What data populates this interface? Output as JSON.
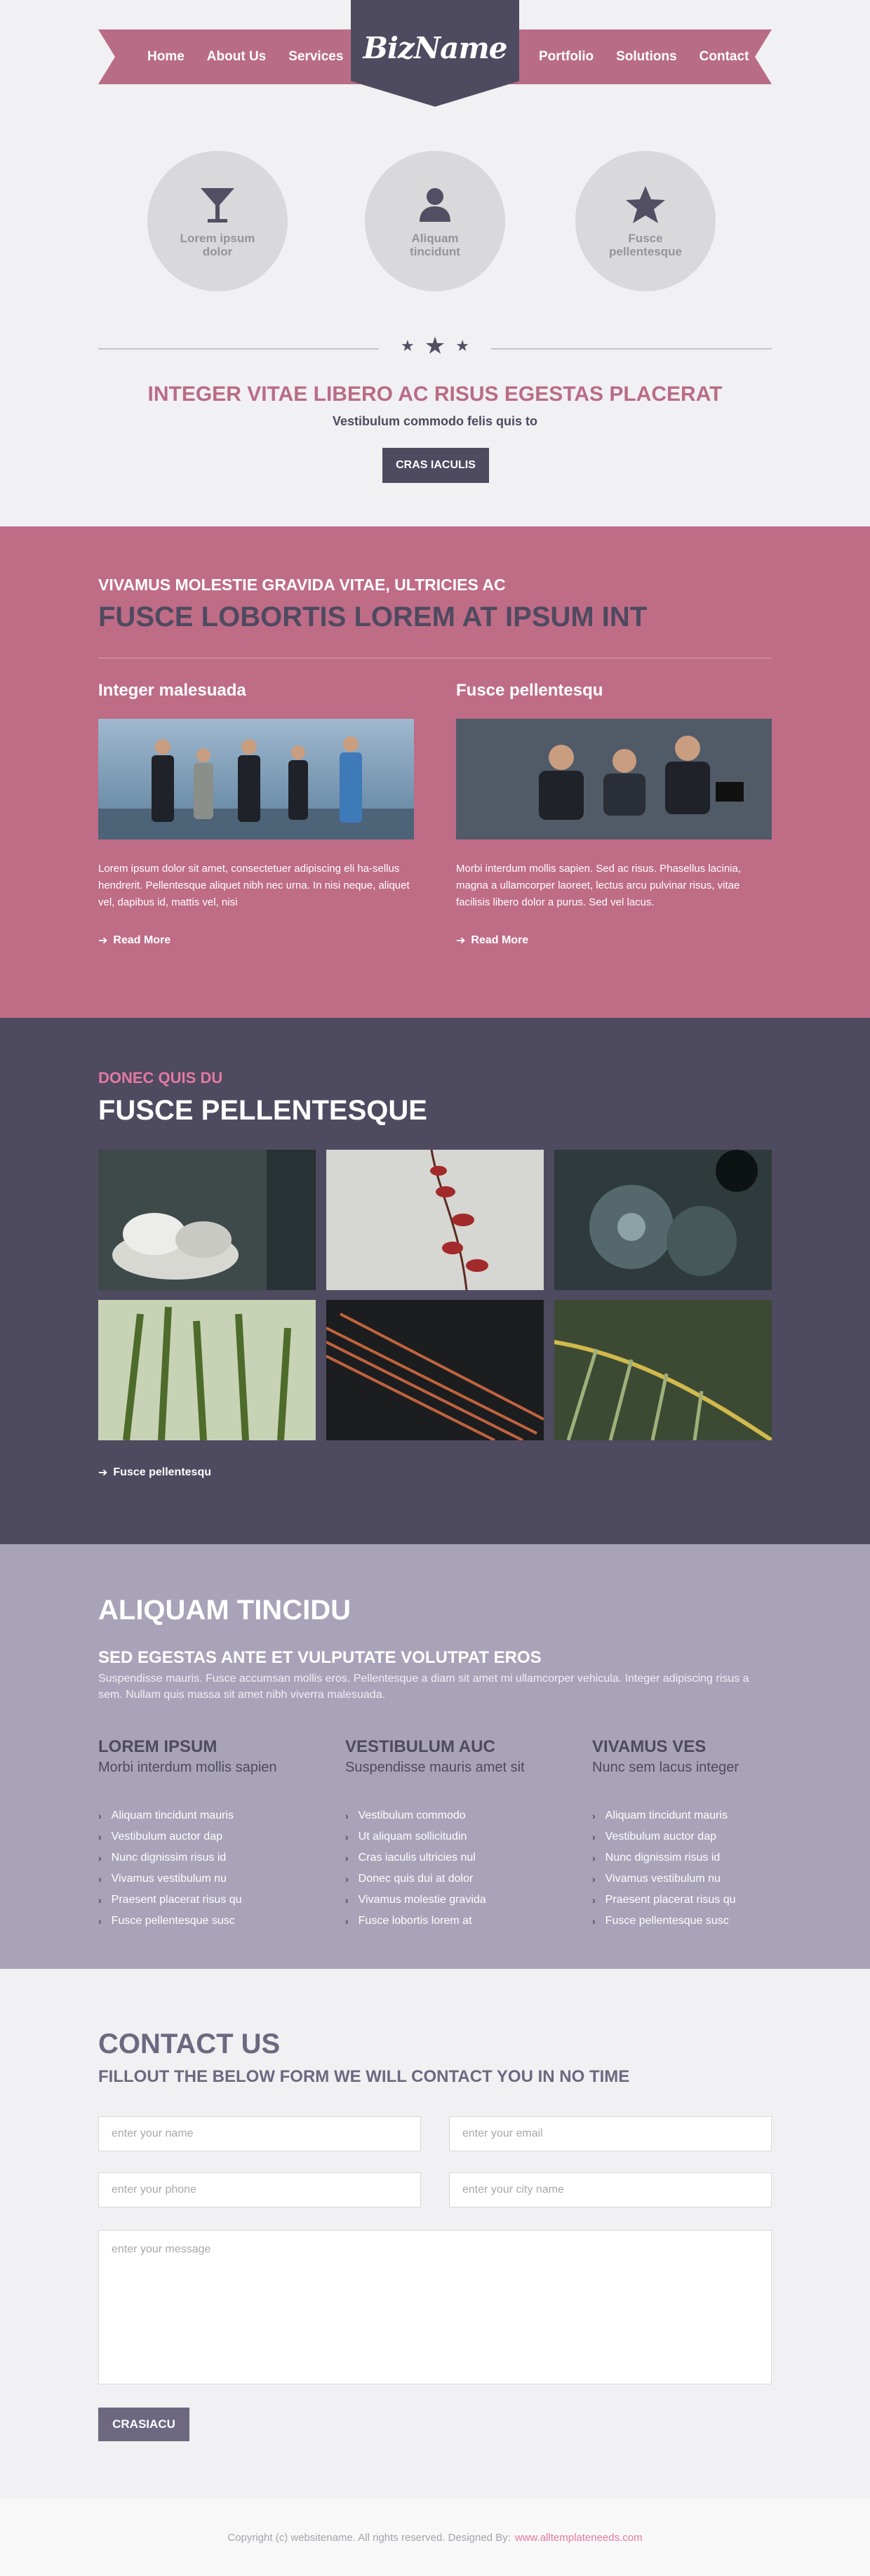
{
  "header": {
    "logo": "BizName",
    "nav_left": [
      "Home",
      "About Us",
      "Services"
    ],
    "nav_right": [
      "Portfolio",
      "Solutions",
      "Contact"
    ]
  },
  "features": [
    {
      "label": "Lorem ipsum dolor",
      "icon": "cocktail-glass-icon"
    },
    {
      "label": "Aliquam tincidunt",
      "icon": "user-icon"
    },
    {
      "label": "Fusce pellentesque",
      "icon": "star-icon"
    }
  ],
  "intro": {
    "title": "INTEGER VITAE LIBERO AC RISUS EGESTAS PLACERAT",
    "subtitle": "Vestibulum commodo felis quis to",
    "button": "CRAS IACULIS"
  },
  "pink": {
    "kicker": "VIVAMUS MOLESTIE GRAVIDA VITAE, ULTRICIES AC",
    "title": "FUSCE LOBORTIS LOREM AT IPSUM INT",
    "columns": [
      {
        "heading": "Integer malesuada",
        "text": "Lorem ipsum dolor sit amet, consectetuer adipiscing eli ha-sellus hendrerit. Pellentesque aliquet nibh nec urna. In nisi neque, aliquet vel, dapibus id, mattis vel, nisi",
        "link": "Read More"
      },
      {
        "heading": "Fusce pellentesqu",
        "text": "Morbi interdum mollis sapien. Sed ac risus. Phasellus lacinia, magna a ullamcorper laoreet, lectus arcu pulvinar risus, vitae facilisis libero dolor a purus. Sed vel lacus.",
        "link": "Read More"
      }
    ]
  },
  "gallery": {
    "kicker": "DONEC QUIS DU",
    "title": "FUSCE PELLENTESQUE",
    "link": "Fusce pellentesqu"
  },
  "lilac": {
    "title": "ALIQUAM TINCIDU",
    "subtitle": "SED EGESTAS ANTE ET VULPUTATE VOLUTPAT EROS",
    "text": "Suspendisse mauris. Fusce accumsan mollis eros. Pellentesque a diam sit amet mi ullamcorper vehicula. Integer adipiscing risus a sem. Nullam quis massa sit amet nibh viverra malesuada.",
    "columns": [
      {
        "heading": "LOREM IPSUM",
        "sub": "Morbi interdum mollis sapien",
        "items": [
          "Aliquam tincidunt mauris",
          "Vestibulum auctor dap",
          "Nunc dignissim risus id",
          "Vivamus vestibulum nu",
          "Praesent placerat risus qu",
          "Fusce pellentesque susc"
        ]
      },
      {
        "heading": "VESTIBULUM AUC",
        "sub": "Suspendisse mauris amet sit",
        "items": [
          "Vestibulum commodo",
          "Ut aliquam sollicitudin",
          "Cras iaculis ultricies nul",
          "Donec quis dui at dolor",
          "Vivamus molestie gravida",
          "Fusce lobortis lorem at"
        ]
      },
      {
        "heading": "VIVAMUS VES",
        "sub": "Nunc sem lacus integer",
        "items": [
          "Aliquam tincidunt mauris",
          "Vestibulum auctor dap",
          "Nunc dignissim risus id",
          "Vivamus vestibulum nu",
          "Praesent placerat risus qu",
          "Fusce pellentesque susc"
        ]
      }
    ]
  },
  "contact": {
    "title": "CONTACT US",
    "subtitle": "FILLOUT THE BELOW FORM WE WILL CONTACT YOU IN NO TIME",
    "name_placeholder": "enter your name",
    "email_placeholder": "enter your email",
    "phone_placeholder": "enter your phone",
    "city_placeholder": "enter your city name",
    "message_placeholder": "enter your message",
    "submit": "CRASIACU"
  },
  "footer": {
    "text": "Copyright (c) websitename. All rights reserved. Designed By:",
    "link": "www.alltemplateneeds.com"
  },
  "colors": {
    "pink": "#bf6c87",
    "dark": "#4e4a60",
    "lilac": "#a8a3b8",
    "accent": "#e37aa0"
  }
}
